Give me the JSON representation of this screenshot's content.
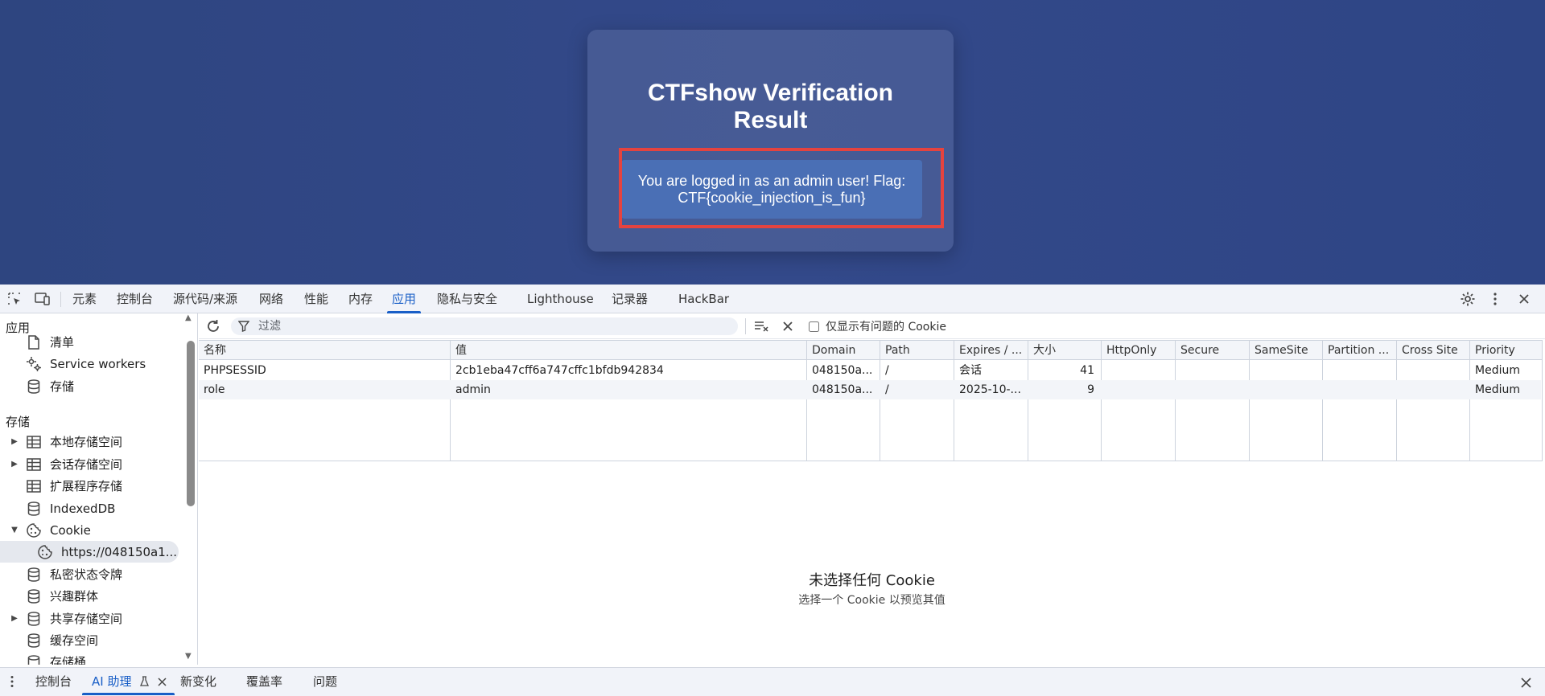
{
  "page": {
    "card_title": "CTFshow Verification Result",
    "message_line1": "You are logged in as an admin user! Flag:",
    "message_line2": "CTF{cookie_injection_is_fun}",
    "colors": {
      "background": "#2f4684",
      "flag_box": "#4a6fb5",
      "highlight": "#e5433f"
    }
  },
  "devtools": {
    "tabs": [
      {
        "label": "元素"
      },
      {
        "label": "控制台"
      },
      {
        "label": "源代码/来源"
      },
      {
        "label": "网络"
      },
      {
        "label": "性能"
      },
      {
        "label": "内存"
      },
      {
        "label": "应用",
        "active": true
      },
      {
        "label": "隐私与安全"
      },
      {
        "label": "Lighthouse"
      },
      {
        "label": "记录器"
      },
      {
        "label": "HackBar"
      }
    ],
    "toolbar_icons": [
      "inspect-element-icon",
      "device-toggle-icon",
      "settings-icon",
      "more-vert-icon",
      "close-icon"
    ],
    "accent": "#1a5fc7"
  },
  "sidebar": {
    "section_app": "应用",
    "app_items": [
      {
        "label": "清单",
        "icon": "document-icon"
      },
      {
        "label": "Service workers",
        "icon": "gears-icon"
      },
      {
        "label": "存储",
        "icon": "database-icon"
      }
    ],
    "section_storage": "存储",
    "storage_items": [
      {
        "label": "本地存储空间",
        "icon": "table-icon",
        "expandable": true
      },
      {
        "label": "会话存储空间",
        "icon": "table-icon",
        "expandable": true
      },
      {
        "label": "扩展程序存储",
        "icon": "table-icon"
      },
      {
        "label": "IndexedDB",
        "icon": "database-icon"
      },
      {
        "label": "Cookie",
        "icon": "cookie-icon",
        "expanded": true
      },
      {
        "label": "https://048150a1...",
        "icon": "cookie-icon",
        "selected": true,
        "child": true
      },
      {
        "label": "私密状态令牌",
        "icon": "database-icon"
      },
      {
        "label": "兴趣群体",
        "icon": "database-icon"
      },
      {
        "label": "共享存储空间",
        "icon": "database-icon",
        "expandable": true
      },
      {
        "label": "缓存空间",
        "icon": "database-icon"
      },
      {
        "label": "存储桶",
        "icon": "database-icon"
      }
    ]
  },
  "cookies": {
    "filter_placeholder": "过滤",
    "only_issues_label": "仅显示有问题的 Cookie",
    "columns": [
      "名称",
      "值",
      "Domain",
      "Path",
      "Expires / ...",
      "大小",
      "HttpOnly",
      "Secure",
      "SameSite",
      "Partition ...",
      "Cross Site",
      "Priority"
    ],
    "rows": [
      {
        "name": "PHPSESSID",
        "value": "2cb1eba47cff6a747cffc1bfdb942834",
        "domain": "048150a...",
        "path": "/",
        "expires": "会话",
        "size": "41",
        "httponly": "",
        "secure": "",
        "samesite": "",
        "partition": "",
        "cross_site": "",
        "priority": "Medium"
      },
      {
        "name": "role",
        "value": "admin",
        "domain": "048150a...",
        "path": "/",
        "expires": "2025-10-...",
        "size": "9",
        "httponly": "",
        "secure": "",
        "samesite": "",
        "partition": "",
        "cross_site": "",
        "priority": "Medium"
      }
    ],
    "empty_title": "未选择任何 Cookie",
    "empty_subtitle": "选择一个 Cookie 以预览其值"
  },
  "drawer": {
    "tabs": [
      {
        "label": "控制台"
      },
      {
        "label": "AI 助理",
        "active": true
      },
      {
        "label": "新变化"
      },
      {
        "label": "覆盖率"
      },
      {
        "label": "问题"
      }
    ]
  }
}
